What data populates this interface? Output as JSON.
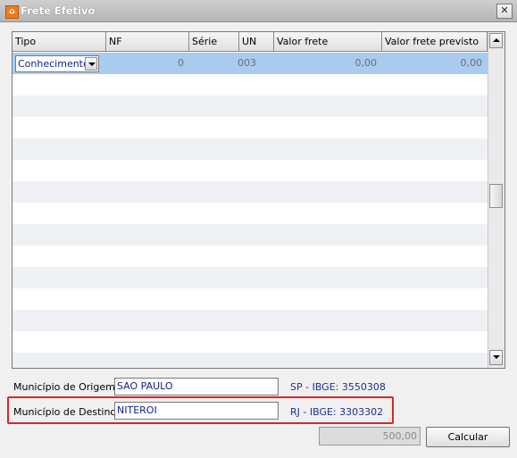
{
  "window": {
    "title": "Frete Efetivo",
    "icon": "home-app-icon",
    "close_glyph": "✕"
  },
  "grid": {
    "columns": [
      "Tipo",
      "NF",
      "Série",
      "UN",
      "Valor frete",
      "Valor frete previsto"
    ],
    "first_row": {
      "tipo": "Conhecimento",
      "nf": "0",
      "serie": "003",
      "un": "",
      "valor_frete": "0,00",
      "valor_frete_previsto": "0,00"
    },
    "selection_color": "#a9cbef"
  },
  "origem": {
    "label": "Município de Origem",
    "value": "SAO PAULO",
    "ibge": "SP - IBGE: 3550308"
  },
  "destino": {
    "label": "Município de Destino",
    "value": "NITEROI",
    "ibge": "RJ - IBGE: 3303302"
  },
  "footer": {
    "result_value": "500,00",
    "calcular_label": "Calcular"
  },
  "colors": {
    "highlight_box": "#d8262b",
    "ibge_text": "#1b2f99"
  }
}
